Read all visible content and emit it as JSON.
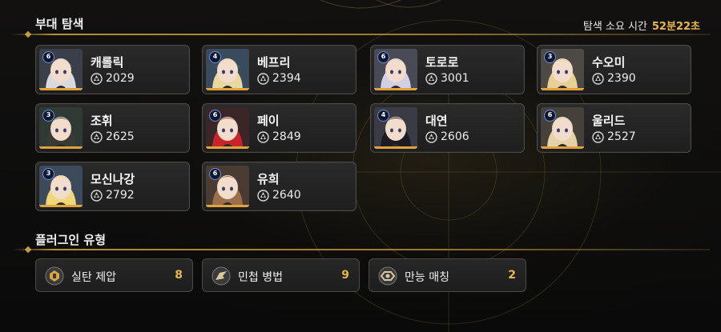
{
  "squad": {
    "title": "부대 탐색",
    "time_label": "탐색 소요 시간",
    "time_value": "52분22초",
    "characters": [
      {
        "name": "캐롤릭",
        "level": "6",
        "power": "2029",
        "hair": "#d9d9de",
        "bg": "#3a3f4a"
      },
      {
        "name": "베프리",
        "level": "4",
        "power": "2394",
        "hair": "#e9d9a0",
        "bg": "#3b4b5e"
      },
      {
        "name": "토로로",
        "level": "6",
        "power": "3001",
        "hair": "#d2cfe6",
        "bg": "#4a4a57"
      },
      {
        "name": "수오미",
        "level": "3",
        "power": "2390",
        "hair": "#e7cf95",
        "bg": "#4d4a45"
      },
      {
        "name": "조휘",
        "level": "3",
        "power": "2625",
        "hair": "#3a3a34",
        "bg": "#2f3a35"
      },
      {
        "name": "페이",
        "level": "6",
        "power": "2849",
        "hair": "#c8242a",
        "bg": "#3a2626"
      },
      {
        "name": "대연",
        "level": "4",
        "power": "2606",
        "hair": "#1c1c22",
        "bg": "#3a3b44"
      },
      {
        "name": "울리드",
        "level": "6",
        "power": "2527",
        "hair": "#e6d2a8",
        "bg": "#45403a"
      },
      {
        "name": "모신나강",
        "level": "3",
        "power": "2792",
        "hair": "#f0d87a",
        "bg": "#3c4a5c"
      },
      {
        "name": "유희",
        "level": "6",
        "power": "2640",
        "hair": "#9b6e4c",
        "bg": "#4a3c33"
      }
    ]
  },
  "plugins": {
    "title": "플러그인 유형",
    "items": [
      {
        "label": "실탄 제압",
        "count": "8",
        "icon": "bullet-suppression-icon"
      },
      {
        "label": "민첩 병법",
        "count": "9",
        "icon": "agile-tactics-icon"
      },
      {
        "label": "만능 매칭",
        "count": "2",
        "icon": "universal-match-icon"
      }
    ]
  },
  "colors": {
    "accent_gold": "#e8b84a",
    "level_badge_border": "#6f8fd6",
    "card_bg": "#242424"
  }
}
